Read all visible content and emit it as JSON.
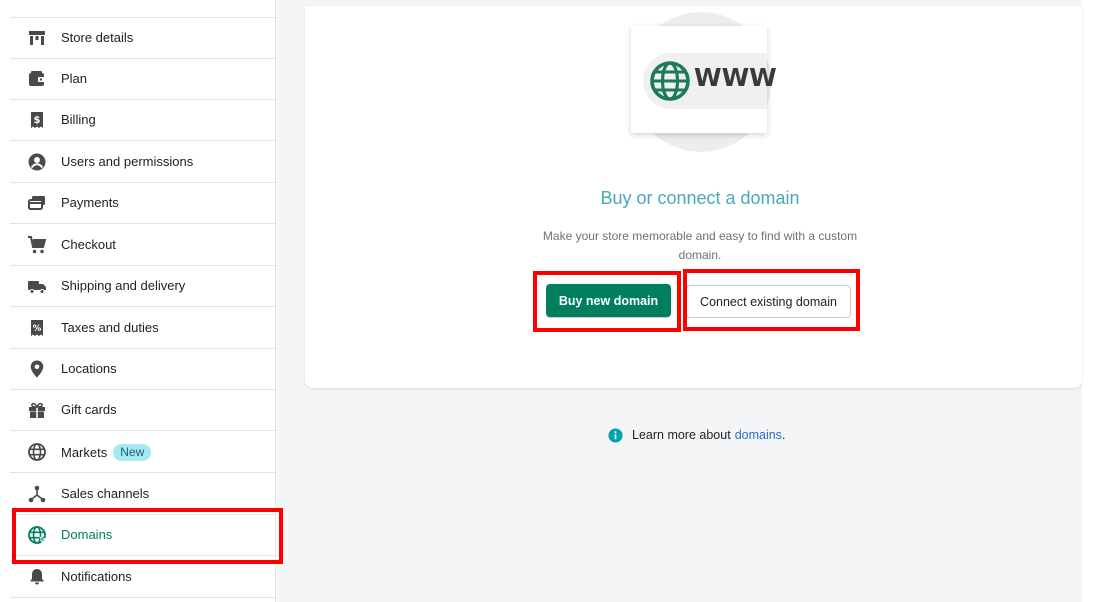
{
  "sidebar": {
    "items": [
      {
        "label": "Store details",
        "icon": "store-icon"
      },
      {
        "label": "Plan",
        "icon": "plan-icon"
      },
      {
        "label": "Billing",
        "icon": "billing-icon"
      },
      {
        "label": "Users and permissions",
        "icon": "user-icon"
      },
      {
        "label": "Payments",
        "icon": "payments-icon"
      },
      {
        "label": "Checkout",
        "icon": "cart-icon"
      },
      {
        "label": "Shipping and delivery",
        "icon": "truck-icon"
      },
      {
        "label": "Taxes and duties",
        "icon": "taxes-icon"
      },
      {
        "label": "Locations",
        "icon": "location-pin-icon"
      },
      {
        "label": "Gift cards",
        "icon": "gift-icon"
      },
      {
        "label": "Markets",
        "icon": "globe-icon",
        "badge": "New"
      },
      {
        "label": "Sales channels",
        "icon": "sales-channels-icon"
      },
      {
        "label": "Domains",
        "icon": "globe-domain-icon",
        "active": true
      },
      {
        "label": "Notifications",
        "icon": "bell-icon"
      }
    ]
  },
  "domain_card": {
    "illustration_text": "WWW",
    "title": "Buy or connect a domain",
    "description": "Make your store memorable and easy to find with a custom domain.",
    "buy_button": "Buy new domain",
    "connect_button": "Connect existing domain"
  },
  "footer": {
    "learn_prefix": "Learn more about",
    "learn_link": "domains",
    "learn_suffix": "."
  },
  "colors": {
    "primary": "#007f5f",
    "title": "#4aa8b8",
    "link": "#2c6ecb",
    "highlight": "#ff0000",
    "badge": "#a4e8f2"
  }
}
